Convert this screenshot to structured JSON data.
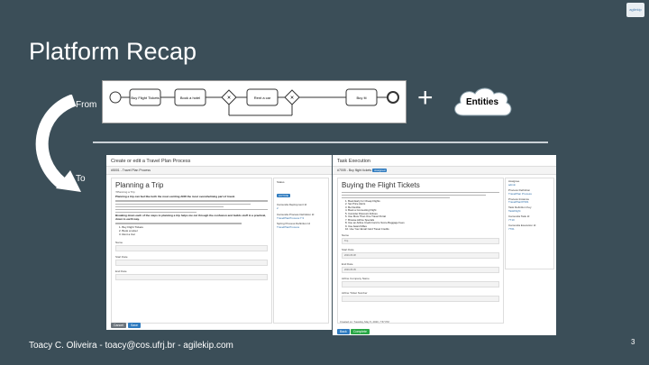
{
  "slide": {
    "title": "Platform Recap",
    "from_label": "From",
    "to_label": "To",
    "plus": "+",
    "entities_label": "Entities",
    "footer": "Toacy C. Oliveira - toacy@cos.ufrj.br - agilekip.com",
    "page_number": "3",
    "logo_text": "agilekip"
  },
  "bpmn": {
    "tasks": [
      "Buy Flight Tickets",
      "Book a hotel",
      "Rent a car",
      "Buy Iti"
    ]
  },
  "create_form": {
    "window_title": "Create or edit a Travel Plan Process",
    "process_id": "#5001 - Travel Plan Process",
    "form_title": "Planning a Trip",
    "form_subtitle": "!!Planning a Trip",
    "bold_line_1": "Planning a trip can feel like both the most exciting AND the most overwhelming part of travel.",
    "bold_line_2": "Breaking down each of the steps to planning a trip helps me cut through the confusion and builds stuff in a practical, down to earth way.",
    "list_items": [
      "1. Buy Flight Tickets",
      "2. Book a Hotel",
      "3. Rent a Car"
    ],
    "field_labels": [
      "Name",
      "Start Date",
      "End Date"
    ],
    "sidebar": [
      {
        "label": "Status",
        "value": "ACTIVE"
      },
      {
        "label": "Camunda Deployment Id",
        "value": "2"
      },
      {
        "label": "Camunda Process Definition Id",
        "value": "TravelPlanProcess:7:3"
      },
      {
        "label": "Spring Process Definition Id",
        "value": "TravelPlanProcess"
      }
    ],
    "buttons": {
      "cancel": "Cancel",
      "save": "Save"
    }
  },
  "task_exec": {
    "window_title": "Task Execution",
    "task_id": "#7005 - Buy flight tickets",
    "task_badge": "Assigned",
    "form_title": "Buying the Flight Tickets",
    "list_items": [
      "1. Book Early for Cheap Flights",
      "2. Set Price Alerts",
      "3. Be Flexible",
      "4. Book a Connecting Flight",
      "5. Consider Discount Airlines",
      "6. Use More Than One Travel Portal",
      "7. Browse Airline Specials",
      "8. Use an Airline Credit Card to Score Baggage Fees",
      "9. Use Award Miles",
      "10. Use Your Email Card Travel Credits"
    ],
    "field_labels": [
      "Name",
      "Start Date",
      "End Date",
      "Airline Company Name",
      "Airline Ticket Number"
    ],
    "field_values": [
      "Trip",
      "2020-05-08",
      "2020-05-09",
      "",
      ""
    ],
    "sidebar": [
      {
        "label": "Assignee",
        "value": "admin"
      },
      {
        "label": "Process Definition",
        "value": "TravelPlan Process"
      },
      {
        "label": "Process Instance",
        "value": "TravelPlan#7001"
      },
      {
        "label": "Task Definition Key",
        "value": "TaskFlight"
      },
      {
        "label": "Camunda Task Id",
        "value": "7710"
      },
      {
        "label": "Camunda Execution Id",
        "value": "7701"
      }
    ],
    "created_on": "Created on: Tuesday, May 5, 2020, 7:57 PM",
    "buttons": {
      "back": "Back",
      "complete": "Complete"
    }
  },
  "colors": {
    "background": "#3b4e58",
    "button_blue": "#2f7bbf",
    "button_green": "#28a745",
    "button_gray": "#6c757d"
  }
}
